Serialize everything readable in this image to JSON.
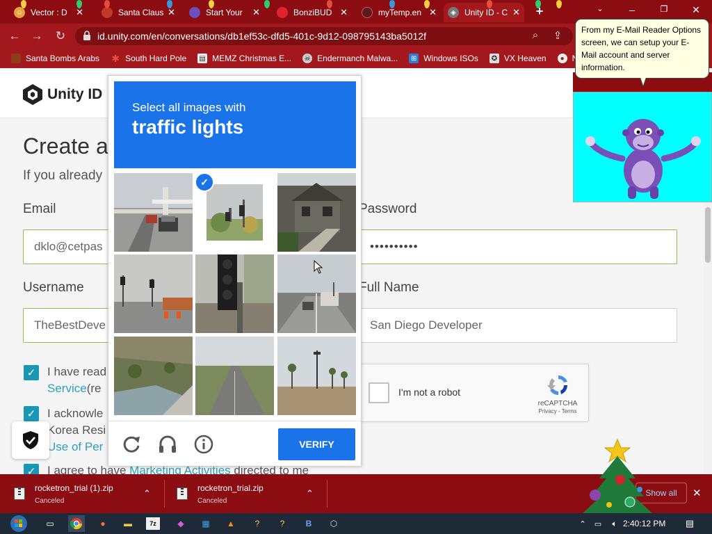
{
  "browser": {
    "tabs": [
      {
        "title": "Vector : D",
        "active": false
      },
      {
        "title": "Santa Claus",
        "active": false
      },
      {
        "title": "Start Your",
        "active": false
      },
      {
        "title": "BonziBUD",
        "active": false
      },
      {
        "title": "myTemp.en",
        "active": false
      },
      {
        "title": "Unity ID - C",
        "active": true
      }
    ],
    "new_tab_label": "+",
    "address": "id.unity.com/en/conversations/db1ef53c-dfd5-401c-9d12-098795143ba5012f",
    "bookmarks": [
      "Santa Bombs Arabs",
      "South Hard Pole",
      "MEMZ Christmas E...",
      "Endermanch Malwa...",
      "Windows ISOs",
      "VX Heaven",
      "N"
    ]
  },
  "page": {
    "logo_text": "Unity ID",
    "title": "Create a",
    "subtitle": "If you already",
    "email_label": "Email",
    "email_value": "dklo@cetpas",
    "password_label": "Password",
    "password_value": "••••••••••",
    "username_label": "Username",
    "username_value": "TheBestDeve",
    "fullname_label": "Full Name",
    "fullname_value": "San Diego Developer",
    "consent1_line1": "I have read",
    "consent1_line2_link": "Service",
    "consent1_line2_rest": "(re",
    "consent2_line1": "I acknowle",
    "consent2_line2": "Korea Resi",
    "consent2_line3_link": "Use of Per",
    "consent3_prefix": "I agree to have",
    "consent3_link": "Marketing Activities",
    "consent3_suffix": "directed to me"
  },
  "recaptcha": {
    "label": "I'm not a robot",
    "brand": "reCAPTCHA",
    "terms": "Privacy - Terms"
  },
  "challenge": {
    "instruction": "Select all images with",
    "target": "traffic lights",
    "verify_label": "VERIFY",
    "selected_tiles": [
      1
    ]
  },
  "bonzi": {
    "speech": "From my E-Mail Reader Options screen, we can setup your E-Mail account and server information."
  },
  "downloads": {
    "items": [
      {
        "name": "rocketron_trial (1).zip",
        "status": "Canceled"
      },
      {
        "name": "rocketron_trial.zip",
        "status": "Canceled"
      }
    ],
    "show_all": "Show all"
  },
  "taskbar": {
    "time": "2:40:12 PM"
  },
  "colors": {
    "chrome_dark": "#8b0d12",
    "chrome": "#a3181d",
    "captcha_blue": "#1a73e8",
    "unity_teal": "#1a97b5",
    "bonzi_cyan": "#00ffff"
  }
}
